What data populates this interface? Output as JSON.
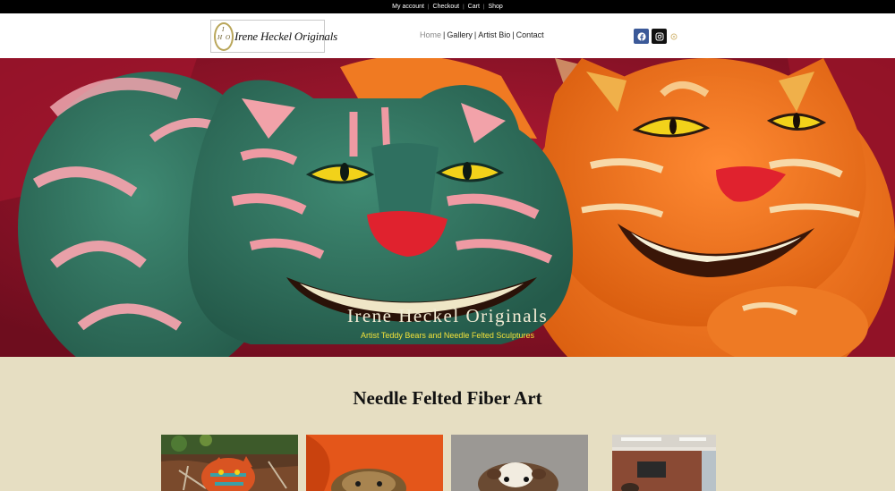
{
  "topbar": {
    "links": [
      "My account",
      "Checkout",
      "Cart",
      "Shop"
    ]
  },
  "header": {
    "logo_text": "Irene Heckel Originals",
    "logo_initials": [
      "I",
      "H",
      "O"
    ],
    "nav": [
      "Home",
      "Gallery",
      "Artist Bio",
      "Contact"
    ],
    "active_nav": "Home",
    "social": [
      "facebook-icon",
      "instagram-icon",
      "other-social-icon"
    ]
  },
  "hero": {
    "title": "Irene Heckel Originals",
    "subtitle": "Artist Teddy Bears and Needle Felted Sculptures"
  },
  "section": {
    "title": "Needle Felted Fiber Art"
  },
  "gallery": {
    "items": [
      "felted-cat-outdoors",
      "felted-bear-orange",
      "felted-guinea-pig",
      "gallery-room-interior"
    ]
  },
  "colors": {
    "page_bg": "#e6dec2",
    "topbar_bg": "#000000",
    "hero_title": "#f3ecd5",
    "hero_subtitle": "#f2e23a",
    "facebook": "#3b5998"
  }
}
